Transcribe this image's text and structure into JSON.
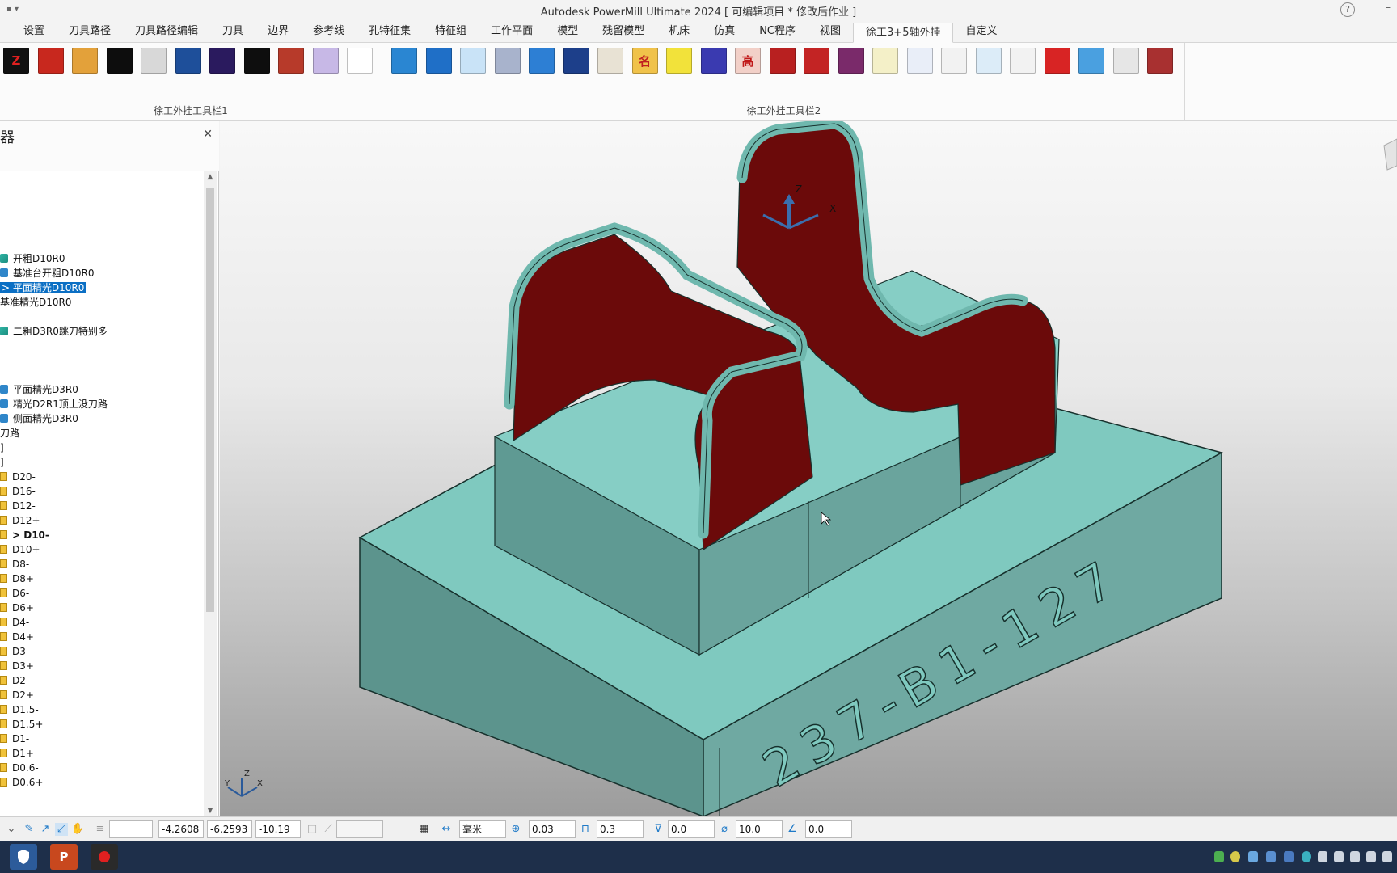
{
  "window": {
    "title": "Autodesk PowerMill Ultimate 2024    [ 可编辑项目 * 修改后作业 ]",
    "help_icon": "question-circle-icon"
  },
  "tabs": [
    {
      "label": "设置"
    },
    {
      "label": "刀具路径"
    },
    {
      "label": "刀具路径编辑"
    },
    {
      "label": "刀具"
    },
    {
      "label": "边界"
    },
    {
      "label": "参考线"
    },
    {
      "label": "孔特征集"
    },
    {
      "label": "特征组"
    },
    {
      "label": "工作平面"
    },
    {
      "label": "模型"
    },
    {
      "label": "残留模型"
    },
    {
      "label": "机床"
    },
    {
      "label": "仿真"
    },
    {
      "label": "NC程序"
    },
    {
      "label": "视图"
    },
    {
      "label": "徐工3+5轴外挂",
      "active": true
    },
    {
      "label": "自定义"
    }
  ],
  "ribbon": {
    "group1_label": "徐工外挂工具栏1",
    "group2_label": "徐工外挂工具栏2",
    "group1_icons": [
      {
        "text": "Z",
        "bg": "#111111",
        "fg": "#e02020"
      },
      {
        "text": "",
        "bg": "#c8281e",
        "fg": "#ffffff"
      },
      {
        "text": "",
        "bg": "#e3a13a",
        "fg": "#8a4a10"
      },
      {
        "text": "",
        "bg": "#0d0d0d",
        "fg": "#ffffff"
      },
      {
        "text": "",
        "bg": "#d8d8d8",
        "fg": "#222222"
      },
      {
        "text": "",
        "bg": "#1e4f9a",
        "fg": "#ffffff"
      },
      {
        "text": "",
        "bg": "#2a1a5e",
        "fg": "#e040e0"
      },
      {
        "text": "",
        "bg": "#0e0e0e",
        "fg": "#ff3030"
      },
      {
        "text": "",
        "bg": "#b73a2a",
        "fg": "#3a6fd8"
      },
      {
        "text": "",
        "bg": "#c7b8e6",
        "fg": "#e09040"
      },
      {
        "text": "",
        "bg": "#ffffff",
        "fg": "#222222"
      }
    ],
    "group2_icons": [
      {
        "text": "",
        "bg": "#2a86d2",
        "fg": "#ffffff"
      },
      {
        "text": "",
        "bg": "#1f6fc7",
        "fg": "#ffffff"
      },
      {
        "text": "",
        "bg": "#c9e3f7",
        "fg": "#1f6fc7"
      },
      {
        "text": "",
        "bg": "#a8b3cc",
        "fg": "#c03070"
      },
      {
        "text": "",
        "bg": "#2d7fd4",
        "fg": "#e03030"
      },
      {
        "text": "",
        "bg": "#1d3f8a",
        "fg": "#e060e0"
      },
      {
        "text": "",
        "bg": "#e8e2d4",
        "fg": "#d03030"
      },
      {
        "text": "名",
        "bg": "#f0c24a",
        "fg": "#c02020"
      },
      {
        "text": "",
        "bg": "#f2e23a",
        "fg": "#c01818"
      },
      {
        "text": "",
        "bg": "#3a3ab0",
        "fg": "#e03030"
      },
      {
        "text": "高",
        "bg": "#f2d0c8",
        "fg": "#c01818"
      },
      {
        "text": "",
        "bg": "#b82020",
        "fg": "#202020"
      },
      {
        "text": "",
        "bg": "#c32424",
        "fg": "#2a2a2a"
      },
      {
        "text": "",
        "bg": "#7a2a6a",
        "fg": "#e03030"
      },
      {
        "text": "",
        "bg": "#f4f0c8",
        "fg": "#2a7a2a"
      },
      {
        "text": "",
        "bg": "#e9eef8",
        "fg": "#2a4ab0"
      },
      {
        "text": "",
        "bg": "#f2f2f2",
        "fg": "#d08020"
      },
      {
        "text": "",
        "bg": "#dcecf8",
        "fg": "#2a7ac8"
      },
      {
        "text": "",
        "bg": "#f2f2f2",
        "fg": "#c01818"
      },
      {
        "text": "",
        "bg": "#d82424",
        "fg": "#ffffff"
      },
      {
        "text": "",
        "bg": "#4aa0e0",
        "fg": "#ffffff"
      },
      {
        "text": "",
        "bg": "#e6e6e6",
        "fg": "#2a6ab0"
      },
      {
        "text": "",
        "bg": "#a83030",
        "fg": "#2aa040"
      }
    ]
  },
  "panel": {
    "title": "器",
    "close_icon": "close-icon",
    "tree": [
      {
        "label": "开粗D10R0",
        "icon": "green",
        "indent": 0,
        "row": 6
      },
      {
        "label": "基准台开粗D10R0",
        "icon": "blue",
        "indent": 0,
        "row": 7
      },
      {
        "label": "> 平面精光D10R0",
        "icon": "none",
        "indent": 0,
        "row": 8,
        "selected": true
      },
      {
        "label": "基准精光D10R0",
        "icon": "none",
        "indent": 0,
        "row": 9
      },
      {
        "label": "二粗D3R0跳刀特别多",
        "icon": "green",
        "indent": 0,
        "row": 11
      },
      {
        "label": "平面精光D3R0",
        "icon": "blue",
        "indent": 0,
        "row": 15
      },
      {
        "label": "精光D2R1顶上没刀路",
        "icon": "blue",
        "indent": 0,
        "row": 16
      },
      {
        "label": "侧面精光D3R0",
        "icon": "blue",
        "indent": 0,
        "row": 17
      },
      {
        "label": "刀路",
        "icon": "none",
        "indent": 0,
        "row": 18
      },
      {
        "label": "]",
        "icon": "none",
        "indent": 0,
        "row": 19
      },
      {
        "label": "]",
        "icon": "none",
        "indent": 0,
        "row": 20
      },
      {
        "label": "D20-",
        "icon": "folder",
        "indent": 0,
        "row": 21
      },
      {
        "label": "D16-",
        "icon": "folder",
        "indent": 0,
        "row": 22
      },
      {
        "label": "D12-",
        "icon": "folder",
        "indent": 0,
        "row": 23
      },
      {
        "label": "D12+",
        "icon": "folder",
        "indent": 0,
        "row": 24
      },
      {
        "label": "> D10-",
        "icon": "folder",
        "indent": 0,
        "row": 25,
        "bold": true
      },
      {
        "label": "D10+",
        "icon": "folder",
        "indent": 0,
        "row": 26
      },
      {
        "label": "D8-",
        "icon": "folder",
        "indent": 0,
        "row": 27
      },
      {
        "label": "D8+",
        "icon": "folder",
        "indent": 0,
        "row": 28
      },
      {
        "label": "D6-",
        "icon": "folder",
        "indent": 0,
        "row": 29
      },
      {
        "label": "D6+",
        "icon": "folder",
        "indent": 0,
        "row": 30
      },
      {
        "label": "D4-",
        "icon": "folder",
        "indent": 0,
        "row": 31
      },
      {
        "label": "D4+",
        "icon": "folder",
        "indent": 0,
        "row": 32
      },
      {
        "label": "D3-",
        "icon": "folder",
        "indent": 0,
        "row": 33
      },
      {
        "label": "D3+",
        "icon": "folder",
        "indent": 0,
        "row": 34
      },
      {
        "label": "D2-",
        "icon": "folder",
        "indent": 0,
        "row": 35
      },
      {
        "label": "D2+",
        "icon": "folder",
        "indent": 0,
        "row": 36
      },
      {
        "label": "D1.5-",
        "icon": "folder",
        "indent": 0,
        "row": 37
      },
      {
        "label": "D1.5+",
        "icon": "folder",
        "indent": 0,
        "row": 38
      },
      {
        "label": "D1-",
        "icon": "folder",
        "indent": 0,
        "row": 39
      },
      {
        "label": "D1+",
        "icon": "folder",
        "indent": 0,
        "row": 40
      },
      {
        "label": "D0.6-",
        "icon": "folder",
        "indent": 0,
        "row": 41
      },
      {
        "label": "D0.6+",
        "icon": "folder",
        "indent": 0,
        "row": 42
      }
    ]
  },
  "viewport": {
    "engraving": "237-B1-127",
    "axis_labels": {
      "z": "Z",
      "x": "X",
      "y": "Y"
    },
    "colors": {
      "stock": "#7fc9bf",
      "stock_side": "#5f9a93",
      "wall": "#6b0a0a",
      "edge": "#17302c"
    }
  },
  "status": {
    "x": "-4.2608",
    "y": "-6.2593",
    "z": "-10.19",
    "units": "毫米",
    "tolerance": "0.03",
    "stepover": "0.3",
    "thickness": "0.0",
    "diameter": "10.0",
    "angle": "0.0"
  },
  "taskbar": {
    "apps": [
      "shield-app-icon",
      "powerpoint-app-icon",
      "recorder-app-icon"
    ]
  }
}
